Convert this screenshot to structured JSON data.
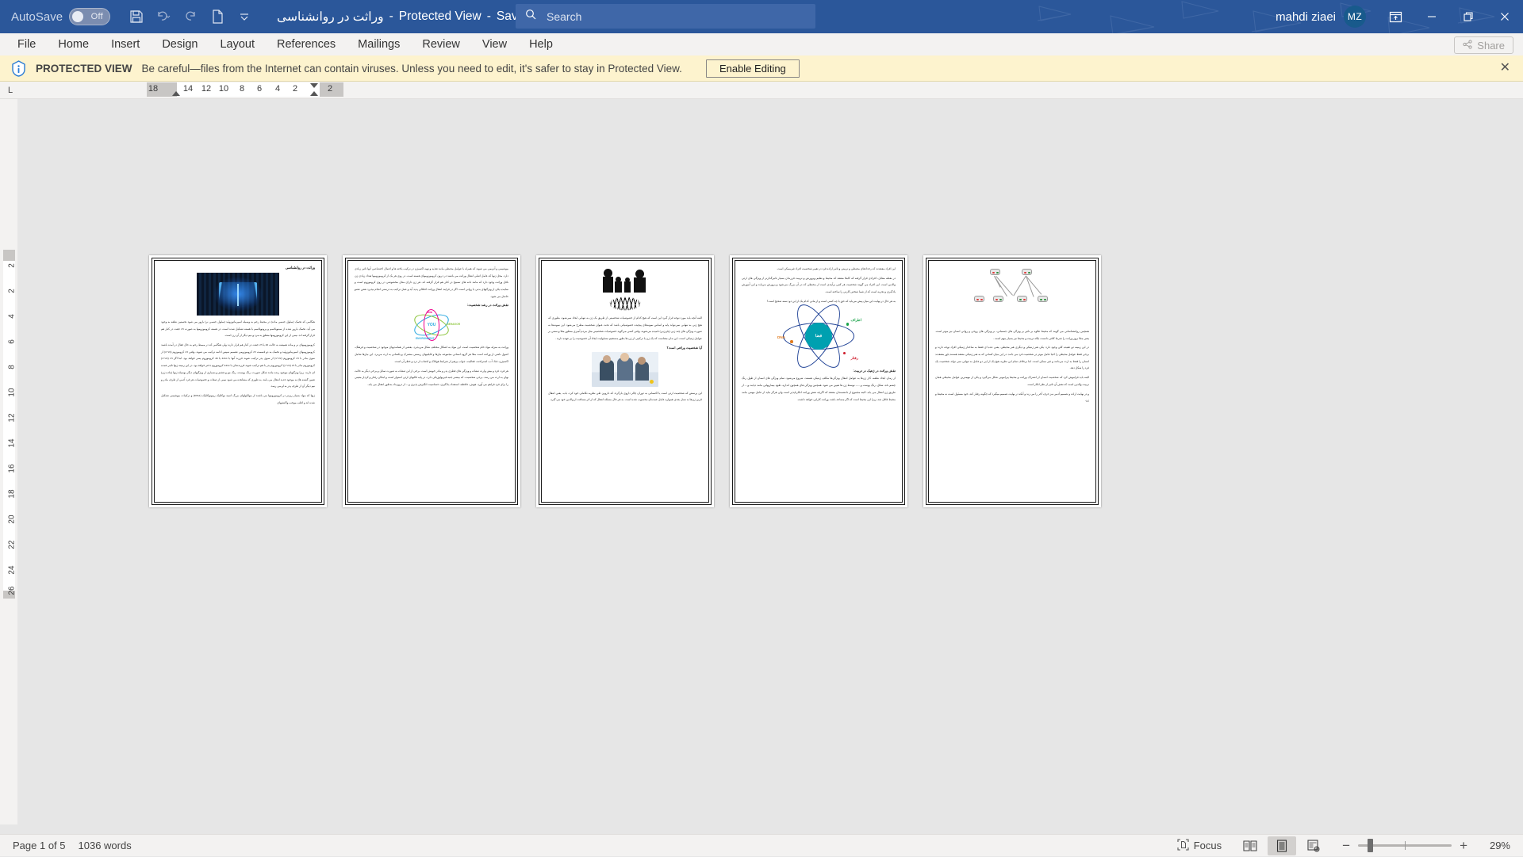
{
  "titlebar": {
    "autosave_label": "AutoSave",
    "autosave_state": "Off",
    "doc_title": "وراثت در روانشناسی",
    "separator": "-",
    "protected_view": "Protected View",
    "saved_state": "Saved to this PC",
    "qat": [
      {
        "name": "save-icon",
        "tooltip": "Save"
      },
      {
        "name": "undo-icon",
        "tooltip": "Undo"
      },
      {
        "name": "redo-icon",
        "tooltip": "Redo"
      },
      {
        "name": "new-document-icon",
        "tooltip": "New"
      },
      {
        "name": "customize-quick-access-toolbar-icon",
        "tooltip": "Customize Quick Access Toolbar"
      }
    ],
    "search_placeholder": "Search",
    "user_name": "mahdi ziaei",
    "user_initials": "MZ",
    "accent_color": "#2b579a",
    "window_buttons": [
      "minimize",
      "restore",
      "close"
    ]
  },
  "ribbon": {
    "tabs": [
      {
        "label": "File"
      },
      {
        "label": "Home"
      },
      {
        "label": "Insert"
      },
      {
        "label": "Design"
      },
      {
        "label": "Layout"
      },
      {
        "label": "References"
      },
      {
        "label": "Mailings"
      },
      {
        "label": "Review"
      },
      {
        "label": "View"
      },
      {
        "label": "Help"
      }
    ],
    "share_label": "Share"
  },
  "protected_view_bar": {
    "badge": "PROTECTED VIEW",
    "message": "Be careful—files from the Internet can contain viruses. Unless you need to edit, it's safer to stay in Protected View.",
    "button_label": "Enable Editing",
    "close_label": "✕",
    "background_color": "#fdf3ce"
  },
  "ruler": {
    "tab_stop_marker": "L",
    "horizontal_ticks": [
      "18",
      "14",
      "12",
      "10",
      "8",
      "6",
      "4",
      "2",
      "2"
    ],
    "vertical_ticks": [
      "2",
      "2",
      "4",
      "6",
      "8",
      "10",
      "12",
      "14",
      "16",
      "18",
      "20",
      "22",
      "24",
      "26"
    ]
  },
  "document": {
    "pages": [
      {
        "page_number": 1,
        "title": "وراثت در روانشناسی",
        "image": "book-circuit-image",
        "paragraphs": [
          "هنگامی که تخمک (سلول جنسی ماده) در محیط رحم به وسیله اسپرماتوزوئید (سلول جنسی نر) بارور می شود نخستین نطفه به وجود می آید. تخمک بارور شده از سیتوپلاسم و پروتوپلاسم با هسته تشکیل شده است. در هسته کروموزومها به صورت 23 جفت در کنار هم قرار گرفته اند. نیمی از این کروموزومها متعلق به مرد و نیم دیگر از آن زن است.",
          "کروموزومهای نر و ماده همیشه به حالت 46 یا 23 جفت در کنار هم قرار دارند ولی هنگامی که در میمط رحم به حال فعال در آمده باشند کروموزومهای اسپرماتوزوئید و تخمک به دو قسمت 23 کروموزومی تقسیم سپس ادامه ترکیب می شوند. وقتی 23 کروموزوم (x+22) از سوی مادر با 23 کروموزوم (x+22) از سوی پدر ترکیب شوند فرزند آنها با 44xx یا 46 کروموزوم پسر خواهد بود. اما اگر 23 (x+22) کروموزوم مادر با 23 (y+22) کروموزوم پدر با هم ترکیب شوند فرزندشان با 44xx کروموزوم دختر خواهد بود. در این زمینه ژنها تاثیر عمده ای دارند. زیرا ویژگیهای موجود زنده مانند شکل صورت، رنگ پوست، رنگ مو و چشم و بسیاری از ویژگیهای دیگر بوسیله ژنها (ماده ژن) تعیین گشته ها) به موجود جدید انتقال می یابند. به طوری که مشاهده می شود نیمی از صفات و خصوصیات هر فرد آدمی از طرف مادر و نیم دیگر آن از طرف پدر به او می رسد.",
          "ژنها که مواد بسیار ریزتر در کروموزومها می باشند از مولکولهای بزرگ اسید نوکلئیک ریبونوکلئیک (DNA) و ترکیبات بیوشیمی تشکیل شده اند و اغلب موجب واکنشهای"
        ]
      },
      {
        "page_number": 2,
        "image": "you-behavior-environment-dna-diagram",
        "heading": "نقش وراثت در رشد شخصیت:",
        "paragraphs": [
          "بیوشیمی و آنزیمی می شوند که همراه با عوامل محیطی مانند تغذیه و تهیه اکسیژن در ترکیب یاخته ها و اعمال اختصاصی آنها تاثیر زیادی دارد. محل ژنها که عامل اصلی انتقال وراثت می باشند در درون کروموزومهای هسته است. در روی هر یک از کروموزومها تعداد زیادی ژن ناقل وراثت وجود دارد که مانند دانه های تسبیح در کنار هم قرار گرفته اند. هر ژن دارای محل مخصوصی در روی کروموزوم است و نماینده یکی از ویژگیهای بدنی یا روانی است. اگر در فرایند انتقال وراثت اختلالی پدید آید و عمل ترکیب به درستی انجام نپذیرد نقص عضو حاصل می شود.",
          "وراثت به منزله مواد خام شخصیت است. این مواد به اشکال مختلف شکل می‌پذیرد. بعضی از همانندیهای موجود در شخصیت و فرهنگ، اصول ناشی از وراثت است مثلا هر گروه انسانی مجموعه نیازها و قابلیتهای زیستی مشترک و یکسانی به ارث می‌برد. این نیازها شامل اکسیژن، غذا، آب، استراحت، فعالیت، جواب پرهیز از شرایط هولناک و اجتناب از درد و خطر آن است.",
          "هر فرد، فرد و بیش وارث صفات و ویژگی های فطری پدر و مادر خویش است. برخی از این صفات به صورت تمایل و برخی دیگر به حالت نهان به ارث می رسد. برخی شخصیت، که بیشتر جنبه فیزیولوژیکی دارد، در پایه قالبهای ارثی استوار است و امکان رفتار و کردار معینی را برای فرد فراهم می آورد. هوش، حافظه، استعداد یادگیری، حساسیت انگیزش پذیری و ... از درون‌داد به‌طور انتقال می یابد."
        ]
      },
      {
        "page_number": 3,
        "image": "family-dna-silhouette",
        "heading": "آیا شخصیت وراثتی است؟",
        "paragraphs": [
          "البته آنچه باید مورد توجه قرار گیرد این است که هیچ کدام از خصوصیات شخصیتی از طریق یک ژن به تنهایی ایجاد نمی‌شود، بطوری که هیچ ژنی به تنهایی نمی‌تواند پایه و اساس نمونه‌های پیچیده خصوصیاتی باشد که تحت عنوان شخصیت مطرح می‌شود. این نمونه‌ها به صورت ویژگی های چند ژنی (پلی‌ژنی) نامیده می‌شوند. وقتی کسی می‌گوید خصوصیات شخصیتی مثل مردم آمیزی منظور مثلا و سنتی بر عوامل ژنتیکی است، این بدان معناست که یک ژن یا ترکیبی از ژن ها بطور مستقیم مسئولیت ایجاد آن خصوصیت را بر عهده دارند .",
          "این پرسش که شخصیت ارثی است یا اکتسابی به دوران چالز داروی بازگردد که داروین طی نظریه تکاملی خود کرد، باب، یعنی انتقال قرین ژن‌ها به نسل بعدی همواره عامل عمده‌ای محسوب شده است. به هر حال مسئله انتقال که از اثر مسافت از والدین خود می گیرد."
        ]
      },
      {
        "page_number": 4,
        "image": "atom-dna-heredity-environment-diagram",
        "image_labels": [
          "DNA",
          "اطراف",
          "فضا",
          "رفتار"
        ],
        "heading": "نقش وراثت در ژنتیک در تربیت:",
        "paragraphs": [
          "این افراد معتقدند که رخدادهای محیطی و تربیتی و تاثیر اراده فرد در تغییر شخصیت افراد غیرممکن است.",
          "در نقطه مقابل، افرادی قرار گرفته که کاملا معتقد که محیط و تعلیم وپرورش و تربیت فرزندان بسیار تاثیرگذارتر از ویژگی های ارثی والدین است. این افراد می گویند شخصیت هر کس برآیندی است از محیطی که در آن بزرگ می‌شود و پرورش می‌یابد و این آموزش یادگیری و تجربه است که از شما شخص کارتی را ساخته است.",
          "به هر حال در نهایت این میان پیش می‌باید که حق با چه کسی است و از مانی کدام یک از این دو دسته صحیح است؟",
          "از زمان ایجاد نطفه، کار ژن‌ها به عوامل انتقال ویژگی‌ها مکلف ژنتیکی هستند، شروع می‌شود. تمام ویژگی های انسان از طول رنگ چشم، قد، شکل، رنگ پوست و ...... توسط ژن ها تعیین می شود. همچنین ویژگی های همچون اندازه، طبع، بیماریهایی مانند دیابت و ... از طریق ژن انتقال می یابد. البته مجموع از دانشمندان معتقد که اگرچه نقش وراثت انکارناپذیر است ولی هرگز نباید از عامل مهمی مانند محیط غافل شد، زیرا این محیط است که اگر مساعد باشد، وراثت کارایی خواهد داشت."
        ]
      },
      {
        "page_number": 5,
        "image": "genetics-inheritance-pedigree-network",
        "paragraphs": [
          "همچنین روانشناسانی می گویند که محیط علاوه بر تاثیر بر ویژگی های جسمانی، بر ویژگی های روحی و روانی انسان نیز موثر است. یعنی مثلا بروز وراثت را شرط کافی دانست بلکه تربیت و محیط نیز بسیار مهم است .",
          "در این زمینه دو عقیده کلی وجود دارد: یکی هنر ژنتیکی و دیگری هنر محیطی. یعنی عده ای فقط به ساختار ژنتیکی افراد توجه دارند و برخی فقط عوامل محیطی را احیا عامل موثر در شخصیت فرد می دانند. در این میان کسانی که به هنر ژنتیکی معتقد هستند باور معتقدند انسان را فقط به ارث می‌دانند و غیر ممکن است. اما برخلاف تمام این نظریه هیچ یک از این دو عامل به تنهایی نمی تواند شخصیت یک فرد را شکل دهد.",
          "البته باید فراموش کرد که شخصیت انسان از اشتراک وراثت و محیط پیرامونی شکل می‌گیرد و یکی از مهمترین عوامل محیطی همان تربیت والدین است که نقش آن تاثیر از نظر انکار است.",
          "و در نهایت اراده و تصمیم آدمی نیز حرف آخر را می زند و آنکه در نهایت تصمیم میگیرد که چگونه رفتار کند، خود مسئول است نه محیط و ژن."
        ]
      }
    ]
  },
  "statusbar": {
    "page_indicator": "Page 1 of 5",
    "word_count": "1036 words",
    "focus_label": "Focus",
    "view_buttons": [
      {
        "name": "read-mode",
        "active": false
      },
      {
        "name": "print-layout",
        "active": true
      },
      {
        "name": "web-layout",
        "active": false
      }
    ],
    "zoom_out_label": "−",
    "zoom_in_label": "+",
    "zoom_level": "29%"
  }
}
